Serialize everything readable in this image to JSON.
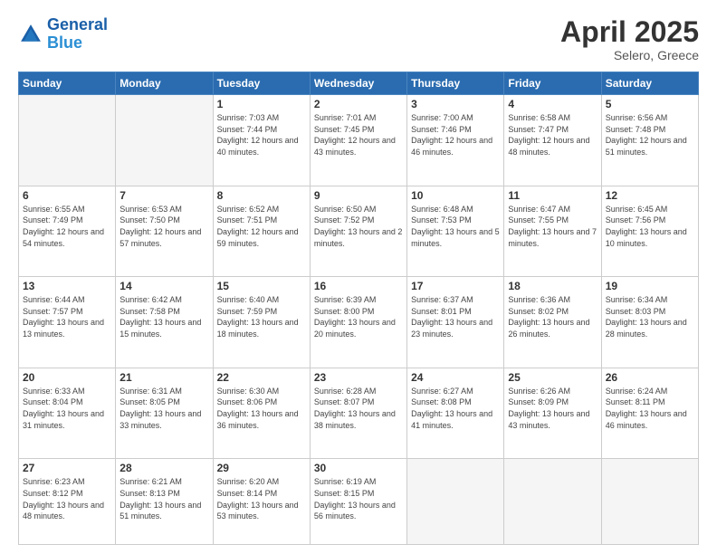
{
  "header": {
    "logo_line1": "General",
    "logo_line2": "Blue",
    "month": "April 2025",
    "location": "Selero, Greece"
  },
  "weekdays": [
    "Sunday",
    "Monday",
    "Tuesday",
    "Wednesday",
    "Thursday",
    "Friday",
    "Saturday"
  ],
  "weeks": [
    [
      {
        "day": "",
        "info": ""
      },
      {
        "day": "",
        "info": ""
      },
      {
        "day": "1",
        "info": "Sunrise: 7:03 AM\nSunset: 7:44 PM\nDaylight: 12 hours and 40 minutes."
      },
      {
        "day": "2",
        "info": "Sunrise: 7:01 AM\nSunset: 7:45 PM\nDaylight: 12 hours and 43 minutes."
      },
      {
        "day": "3",
        "info": "Sunrise: 7:00 AM\nSunset: 7:46 PM\nDaylight: 12 hours and 46 minutes."
      },
      {
        "day": "4",
        "info": "Sunrise: 6:58 AM\nSunset: 7:47 PM\nDaylight: 12 hours and 48 minutes."
      },
      {
        "day": "5",
        "info": "Sunrise: 6:56 AM\nSunset: 7:48 PM\nDaylight: 12 hours and 51 minutes."
      }
    ],
    [
      {
        "day": "6",
        "info": "Sunrise: 6:55 AM\nSunset: 7:49 PM\nDaylight: 12 hours and 54 minutes."
      },
      {
        "day": "7",
        "info": "Sunrise: 6:53 AM\nSunset: 7:50 PM\nDaylight: 12 hours and 57 minutes."
      },
      {
        "day": "8",
        "info": "Sunrise: 6:52 AM\nSunset: 7:51 PM\nDaylight: 12 hours and 59 minutes."
      },
      {
        "day": "9",
        "info": "Sunrise: 6:50 AM\nSunset: 7:52 PM\nDaylight: 13 hours and 2 minutes."
      },
      {
        "day": "10",
        "info": "Sunrise: 6:48 AM\nSunset: 7:53 PM\nDaylight: 13 hours and 5 minutes."
      },
      {
        "day": "11",
        "info": "Sunrise: 6:47 AM\nSunset: 7:55 PM\nDaylight: 13 hours and 7 minutes."
      },
      {
        "day": "12",
        "info": "Sunrise: 6:45 AM\nSunset: 7:56 PM\nDaylight: 13 hours and 10 minutes."
      }
    ],
    [
      {
        "day": "13",
        "info": "Sunrise: 6:44 AM\nSunset: 7:57 PM\nDaylight: 13 hours and 13 minutes."
      },
      {
        "day": "14",
        "info": "Sunrise: 6:42 AM\nSunset: 7:58 PM\nDaylight: 13 hours and 15 minutes."
      },
      {
        "day": "15",
        "info": "Sunrise: 6:40 AM\nSunset: 7:59 PM\nDaylight: 13 hours and 18 minutes."
      },
      {
        "day": "16",
        "info": "Sunrise: 6:39 AM\nSunset: 8:00 PM\nDaylight: 13 hours and 20 minutes."
      },
      {
        "day": "17",
        "info": "Sunrise: 6:37 AM\nSunset: 8:01 PM\nDaylight: 13 hours and 23 minutes."
      },
      {
        "day": "18",
        "info": "Sunrise: 6:36 AM\nSunset: 8:02 PM\nDaylight: 13 hours and 26 minutes."
      },
      {
        "day": "19",
        "info": "Sunrise: 6:34 AM\nSunset: 8:03 PM\nDaylight: 13 hours and 28 minutes."
      }
    ],
    [
      {
        "day": "20",
        "info": "Sunrise: 6:33 AM\nSunset: 8:04 PM\nDaylight: 13 hours and 31 minutes."
      },
      {
        "day": "21",
        "info": "Sunrise: 6:31 AM\nSunset: 8:05 PM\nDaylight: 13 hours and 33 minutes."
      },
      {
        "day": "22",
        "info": "Sunrise: 6:30 AM\nSunset: 8:06 PM\nDaylight: 13 hours and 36 minutes."
      },
      {
        "day": "23",
        "info": "Sunrise: 6:28 AM\nSunset: 8:07 PM\nDaylight: 13 hours and 38 minutes."
      },
      {
        "day": "24",
        "info": "Sunrise: 6:27 AM\nSunset: 8:08 PM\nDaylight: 13 hours and 41 minutes."
      },
      {
        "day": "25",
        "info": "Sunrise: 6:26 AM\nSunset: 8:09 PM\nDaylight: 13 hours and 43 minutes."
      },
      {
        "day": "26",
        "info": "Sunrise: 6:24 AM\nSunset: 8:11 PM\nDaylight: 13 hours and 46 minutes."
      }
    ],
    [
      {
        "day": "27",
        "info": "Sunrise: 6:23 AM\nSunset: 8:12 PM\nDaylight: 13 hours and 48 minutes."
      },
      {
        "day": "28",
        "info": "Sunrise: 6:21 AM\nSunset: 8:13 PM\nDaylight: 13 hours and 51 minutes."
      },
      {
        "day": "29",
        "info": "Sunrise: 6:20 AM\nSunset: 8:14 PM\nDaylight: 13 hours and 53 minutes."
      },
      {
        "day": "30",
        "info": "Sunrise: 6:19 AM\nSunset: 8:15 PM\nDaylight: 13 hours and 56 minutes."
      },
      {
        "day": "",
        "info": ""
      },
      {
        "day": "",
        "info": ""
      },
      {
        "day": "",
        "info": ""
      }
    ]
  ]
}
